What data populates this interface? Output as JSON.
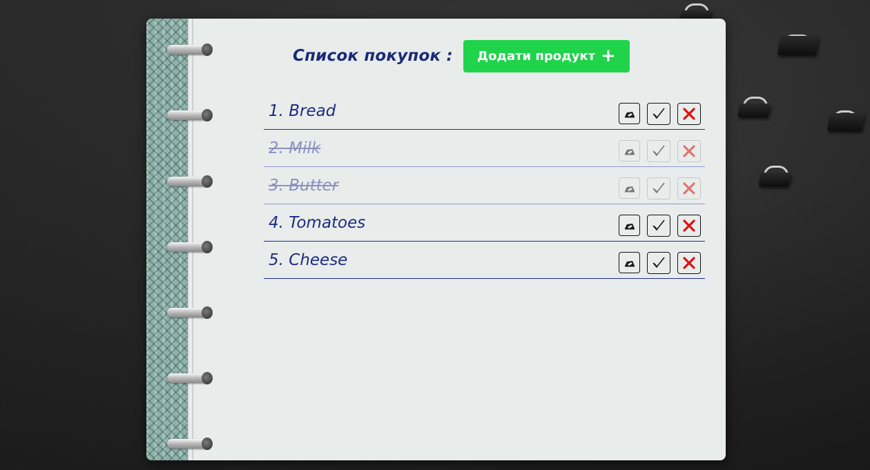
{
  "header": {
    "title": "Список покупок :",
    "add_button_label": "Додати продукт",
    "add_button_icon": "plus-icon"
  },
  "items": [
    {
      "label": "1. Bread",
      "done": false
    },
    {
      "label": "2. Milk",
      "done": true
    },
    {
      "label": "3. Butter",
      "done": true
    },
    {
      "label": "4. Tomatoes",
      "done": false
    },
    {
      "label": "5. Cheese",
      "done": false
    }
  ],
  "item_actions": {
    "edit_icon": "edit-icon",
    "check_icon": "check-icon",
    "delete_icon": "close-icon"
  },
  "colors": {
    "accent": "#1fd44a",
    "text": "#1e2a86",
    "delete": "#e01010",
    "paper": "#e8edeb"
  }
}
